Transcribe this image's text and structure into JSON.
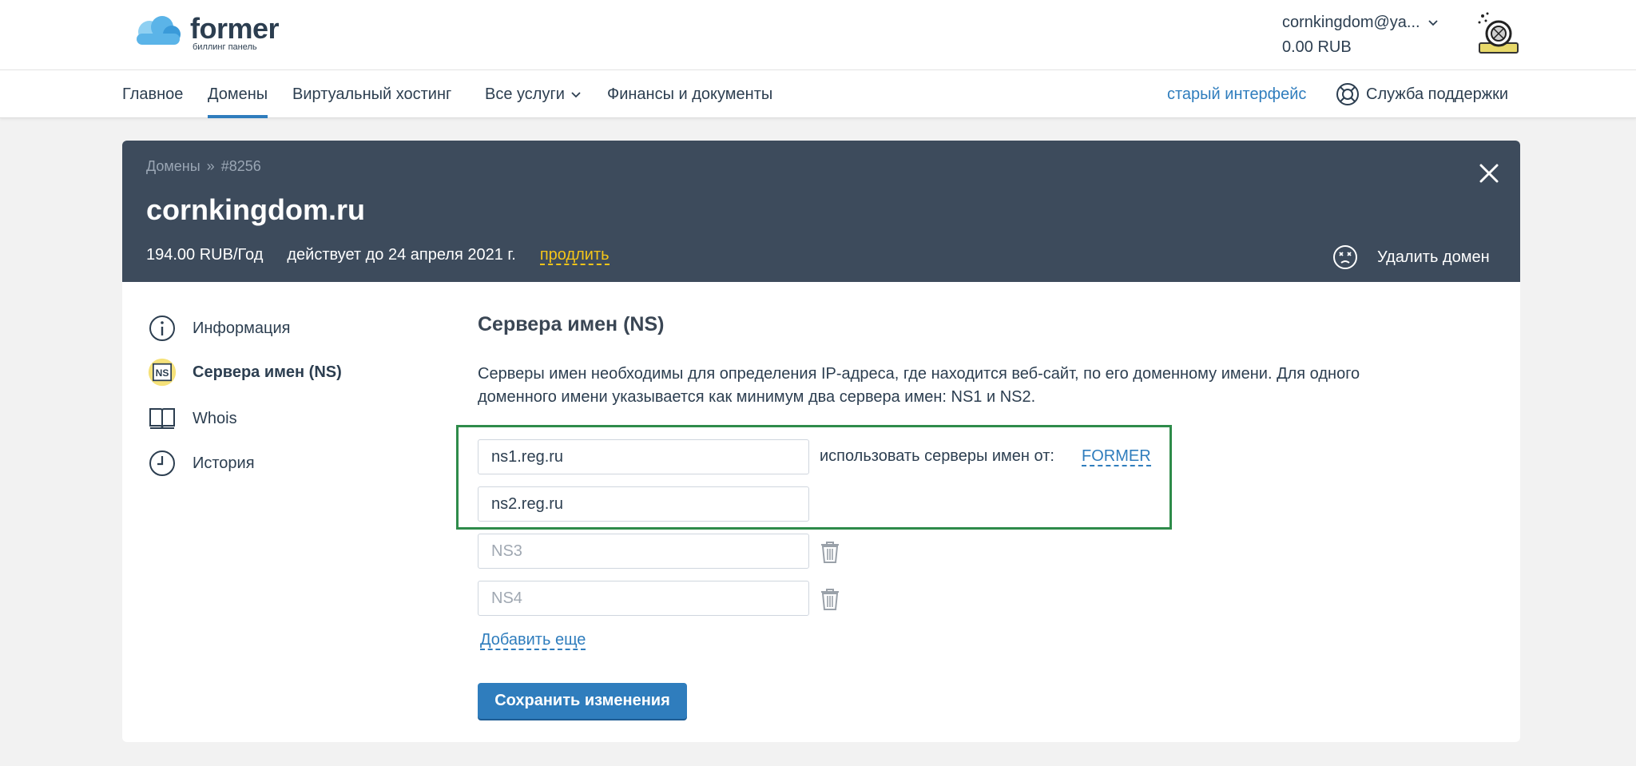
{
  "brand": {
    "name": "former",
    "subtitle": "биллинг панель",
    "cloud_color": "#5bb4e8"
  },
  "account": {
    "email": "cornkingdom@ya...",
    "balance": "0.00 RUB"
  },
  "nav": {
    "items": [
      {
        "label": "Главное"
      },
      {
        "label": "Домены",
        "active": true
      },
      {
        "label": "Виртуальный хостинг"
      },
      {
        "label": "Все услуги",
        "dropdown": true
      },
      {
        "label": "Финансы и документы"
      }
    ],
    "old_interface": "старый интерфейс",
    "support": "Служба поддержки"
  },
  "domain": {
    "breadcrumb_root": "Домены",
    "breadcrumb_sep": "»",
    "breadcrumb_id": "#8256",
    "name": "cornkingdom.ru",
    "price": "194.00 RUB/Год",
    "valid_until": "действует до 24 апреля 2021 г.",
    "renew": "продлить",
    "delete": "Удалить домен"
  },
  "sidebar": {
    "items": [
      {
        "label": "Информация",
        "icon": "info-icon"
      },
      {
        "label": "Сервера имен (NS)",
        "icon": "ns-icon",
        "active": true
      },
      {
        "label": "Whois",
        "icon": "book-icon"
      },
      {
        "label": "История",
        "icon": "clock-icon"
      }
    ]
  },
  "ns": {
    "title": "Сервера имен (NS)",
    "description": "Серверы имен необходимы для определения IP-адреса, где находится веб-сайт, по его доменному имени. Для одного доменного имени указывается как минимум два сервера имен: NS1 и NS2.",
    "fields": [
      {
        "value": "ns1.reg.ru",
        "placeholder": ""
      },
      {
        "value": "ns2.reg.ru",
        "placeholder": ""
      },
      {
        "value": "",
        "placeholder": "NS3"
      },
      {
        "value": "",
        "placeholder": "NS4"
      }
    ],
    "use_servers_label": "использовать серверы имен от:",
    "use_servers_provider": "FORMER",
    "add_more": "Добавить еще",
    "save": "Сохранить изменения"
  },
  "colors": {
    "accent": "#2f7dbd",
    "header_bg": "#3d4b5c",
    "highlight": "#2e8b4a",
    "renew": "#f5c518"
  }
}
